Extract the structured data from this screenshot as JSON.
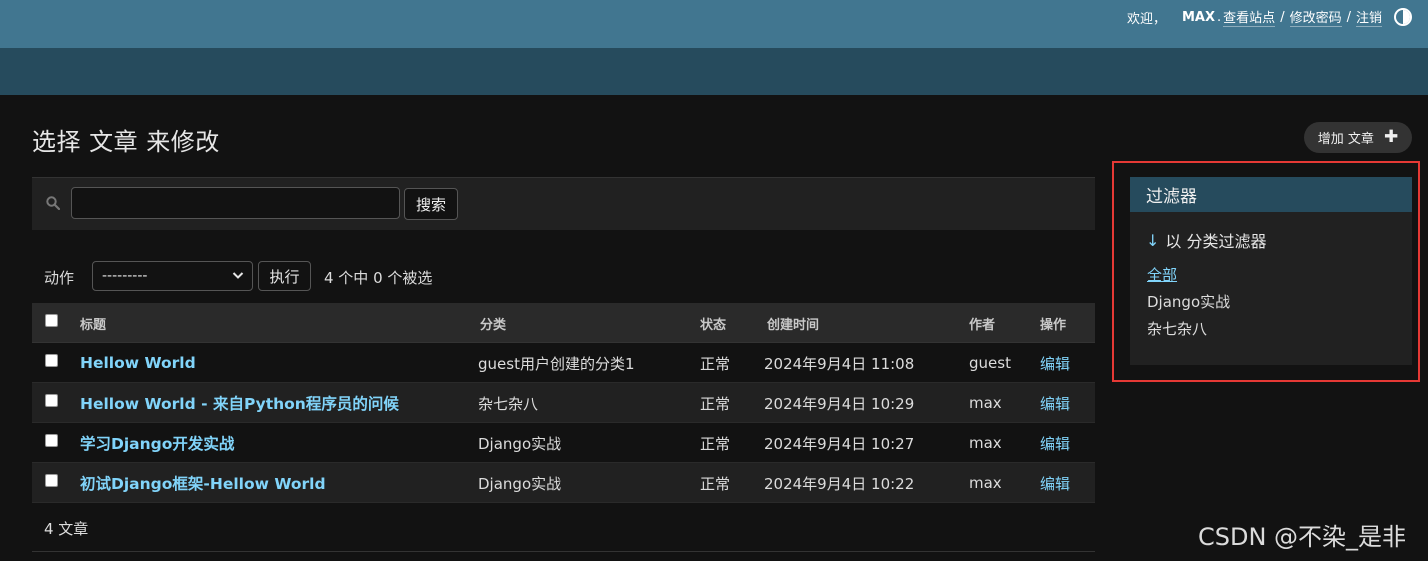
{
  "header": {
    "welcome": "欢迎，",
    "username": "MAX",
    "period": ".",
    "view_site": "查看站点",
    "change_password": "修改密码",
    "logout": "注销",
    "sep": "/"
  },
  "page": {
    "title": "选择 文章 来修改",
    "add_button": "增加 文章",
    "add_icon": "plus-icon"
  },
  "search": {
    "value": "",
    "placeholder": "",
    "button": "搜索",
    "icon": "search-icon"
  },
  "actions": {
    "label": "动作",
    "selected": "---------",
    "go": "执行",
    "counter": "4 个中 0 个被选"
  },
  "table": {
    "headers": {
      "title": "标题",
      "category": "分类",
      "status": "状态",
      "created": "创建时间",
      "author": "作者",
      "operation": "操作"
    },
    "rows": [
      {
        "title": "Hellow World",
        "category": "guest用户创建的分类1",
        "status": "正常",
        "created": "2024年9月4日 11:08",
        "author": "guest",
        "op": "编辑"
      },
      {
        "title": "Hellow World - 来自Python程序员的问候",
        "category": "杂七杂八",
        "status": "正常",
        "created": "2024年9月4日 10:29",
        "author": "max",
        "op": "编辑"
      },
      {
        "title": "学习Django开发实战",
        "category": "Django实战",
        "status": "正常",
        "created": "2024年9月4日 10:27",
        "author": "max",
        "op": "编辑"
      },
      {
        "title": "初试Django框架-Hellow World",
        "category": "Django实战",
        "status": "正常",
        "created": "2024年9月4日 10:22",
        "author": "max",
        "op": "编辑"
      }
    ],
    "footer": "4 文章"
  },
  "filter": {
    "title": "过滤器",
    "arrow": "↓",
    "by": "以 分类过滤器",
    "options": [
      "全部",
      "Django实战",
      "杂七杂八"
    ],
    "selected": "全部"
  },
  "watermark": "CSDN @不染_是非",
  "colors": {
    "header": "#417690",
    "navbar": "#264b5d",
    "link": "#81d4fa",
    "highlight": "#e53935"
  }
}
